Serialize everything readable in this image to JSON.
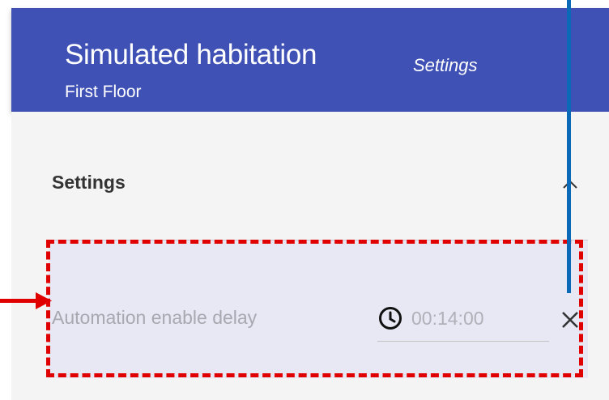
{
  "app_bar": {
    "title": "Simulated habitation",
    "subtitle": "Settings",
    "floor": "First Floor"
  },
  "section": {
    "title": "Settings",
    "toggle_icon": "chevron-up-icon"
  },
  "setting_row": {
    "label": "Automation enable delay",
    "time_icon": "clock-icon",
    "time_value": "00:14:00",
    "clear_icon": "close-icon"
  },
  "colors": {
    "app_bar": "#3f51b5",
    "content_bg": "#f4f4f4",
    "row_bg": "#e8e8f4",
    "annotation_red": "#e00000",
    "annotation_blue": "#0a6ab8"
  }
}
